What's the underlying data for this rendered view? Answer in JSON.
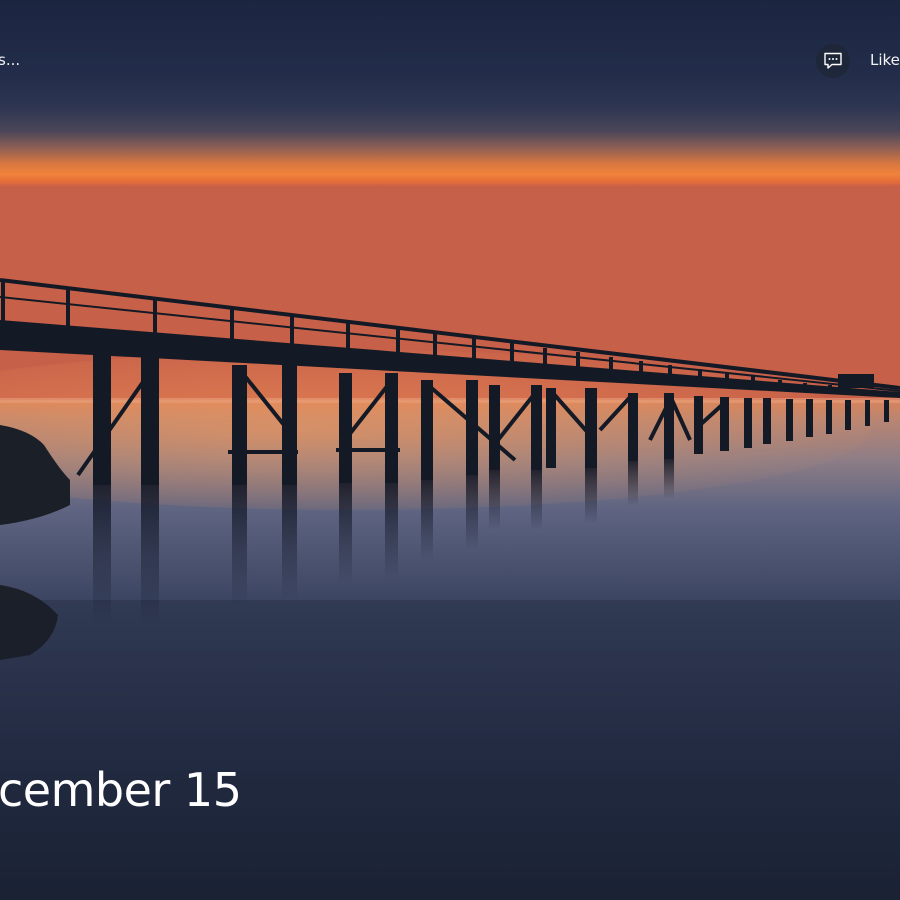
{
  "lock_screen": {
    "top_left_text": "s...",
    "like_label": "Like",
    "date_text": "cember 15",
    "comment_icon": "comment-icon"
  },
  "colors": {
    "sky_top": "#1e2944",
    "sky_glow": "#f0793a",
    "water": "#2a3450",
    "text": "#ffffff"
  }
}
